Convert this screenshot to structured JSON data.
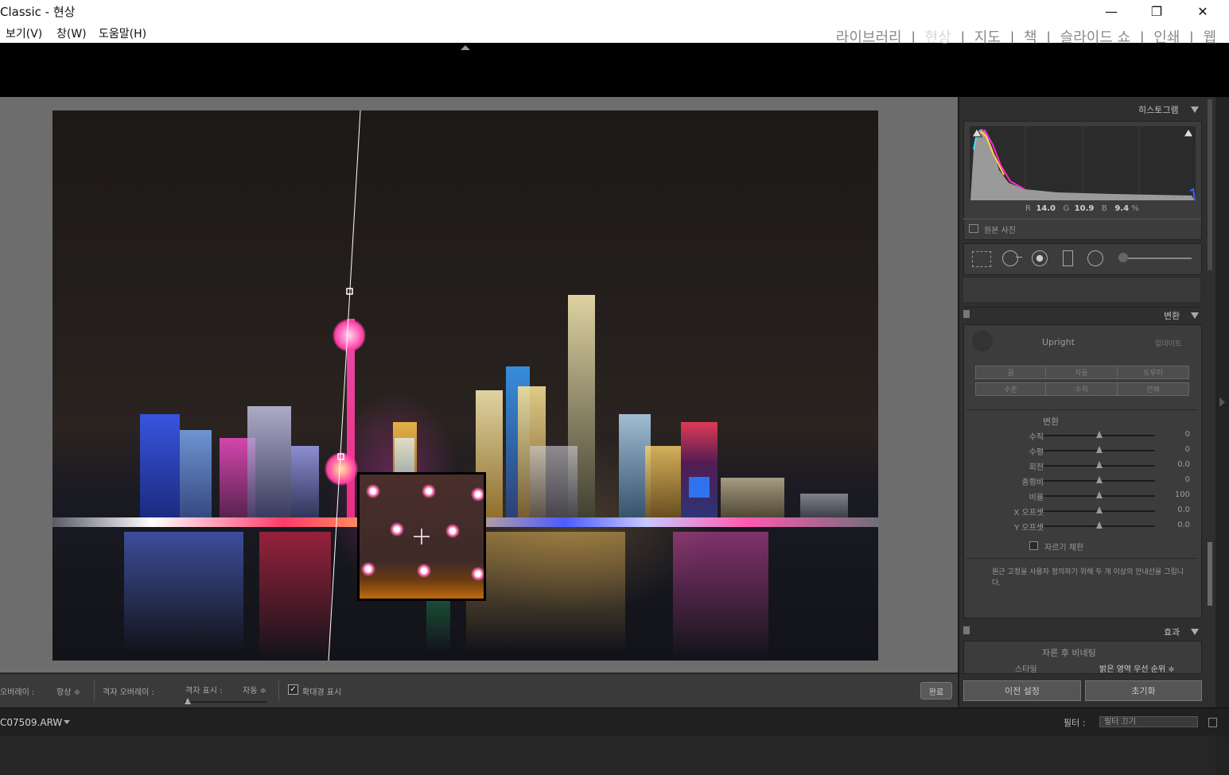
{
  "window": {
    "title": "Classic - 현상",
    "minimize_glyph": "—",
    "restore_glyph": "❐",
    "close_glyph": "✕"
  },
  "menu": {
    "items": [
      "보기(V)",
      "창(W)",
      "도움말(H)"
    ]
  },
  "modules": {
    "items": [
      "라이브러리",
      "현상",
      "지도",
      "책",
      "슬라이드 쇼",
      "인쇄",
      "웹"
    ],
    "active": "현상"
  },
  "histogram": {
    "title": "히스토그램",
    "r_label": "R",
    "r_value": "14.0",
    "g_label": "G",
    "g_value": "10.9",
    "b_label": "B",
    "b_value": "9.4",
    "unit": "%",
    "original_photo_label": "원본 사진"
  },
  "transform": {
    "title": "변환",
    "upright_label": "Upright",
    "update_label": "업데이트",
    "buttons_row1": [
      "끔",
      "자동",
      "도우미"
    ],
    "buttons_row2": [
      "수준",
      "수직",
      "전체"
    ],
    "section_label": "변환",
    "sliders": [
      {
        "label": "수직",
        "value": "0",
        "position": 0.5
      },
      {
        "label": "수평",
        "value": "0",
        "position": 0.5
      },
      {
        "label": "회전",
        "value": "0.0",
        "position": 0.5
      },
      {
        "label": "종횡비",
        "value": "0",
        "position": 0.5
      },
      {
        "label": "비율",
        "value": "100",
        "position": 0.5
      },
      {
        "label": "X 오프셋",
        "value": "0.0",
        "position": 0.5
      },
      {
        "label": "Y 오프셋",
        "value": "0.0",
        "position": 0.5
      }
    ],
    "crop_limit_label": "자르기 제한",
    "help_text": "원근 고정을 사용자 정의하기 위해 두 개 이상의 안내선을 그립니다."
  },
  "effects": {
    "title": "효과",
    "vignette_label": "자른 후 비네팅",
    "style_label": "스타일",
    "style_value": "밝은 영역 우선 순위 ≑"
  },
  "bottom_buttons": {
    "previous": "이전 설정",
    "reset": "초기화"
  },
  "toolbar": {
    "overlay_label": "오버레이 :",
    "overlay_value": "항상 ≑",
    "grid_overlay_label": "격자 오버레이 :",
    "grid_show_label": "격자 표시 :",
    "grid_show_value": "자동 ≑",
    "loupe_label": "확대경 표시",
    "done_label": "완료"
  },
  "filmstrip": {
    "filename": "C07509.ARW",
    "filter_label": "필터 :",
    "filter_value": "필터 끄기"
  }
}
